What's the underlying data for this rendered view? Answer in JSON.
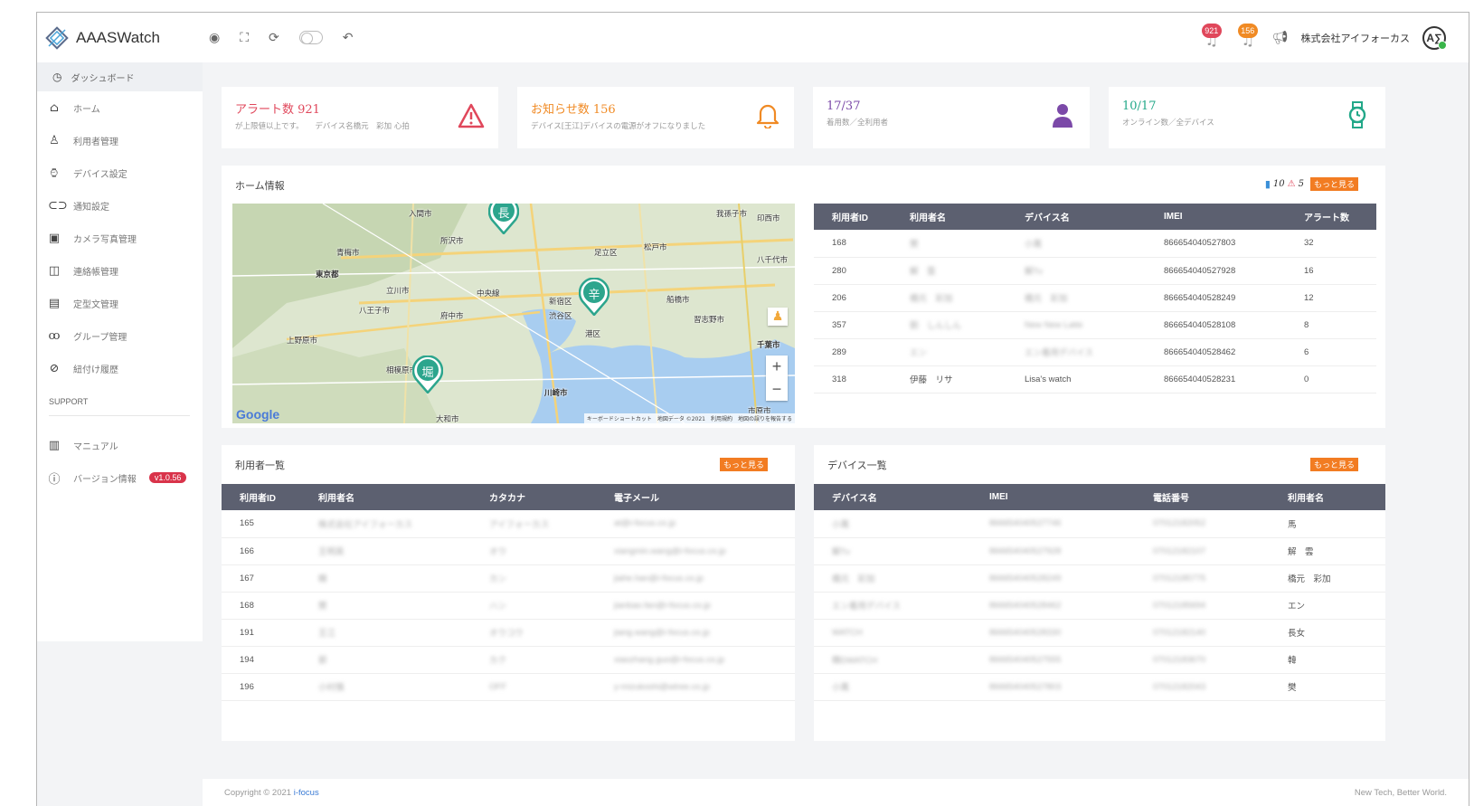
{
  "app": {
    "name": "AAASWatch"
  },
  "topbar": {
    "alerts_badge": "921",
    "notices_badge": "156",
    "company": "株式会社アイフォーカス",
    "avatar_text": "A∑"
  },
  "sidebar": {
    "header": "ダッシュボード",
    "items": [
      {
        "label": "ホーム",
        "icon": "home-icon"
      },
      {
        "label": "利用者管理",
        "icon": "user-icon"
      },
      {
        "label": "デバイス設定",
        "icon": "watch-icon"
      },
      {
        "label": "通知設定",
        "icon": "link-icon"
      },
      {
        "label": "カメラ写真管理",
        "icon": "image-icon"
      },
      {
        "label": "連絡帳管理",
        "icon": "book-icon"
      },
      {
        "label": "定型文管理",
        "icon": "document-icon"
      },
      {
        "label": "グループ管理",
        "icon": "group-icon"
      },
      {
        "label": "紐付け履歴",
        "icon": "chain-icon"
      }
    ],
    "support_label": "SUPPORT",
    "manual": "マニュアル",
    "version_label": "バージョン情報",
    "version": "v1.0.56"
  },
  "stats": {
    "alerts": {
      "title": "アラート数 921",
      "sub": "が上限値以上です。　　デバイス名橋元　彩加 心拍",
      "color": "#e0475b"
    },
    "notices": {
      "title": "お知らせ数 156",
      "sub": "デバイス[王江]デバイスの電源がオフになりました",
      "color": "#f08a24"
    },
    "wearing": {
      "title": "17/37",
      "sub": "着用数／全利用者",
      "color": "#7b49a8"
    },
    "online": {
      "title": "10/17",
      "sub": "オンライン数／全デバイス",
      "color": "#23a889"
    }
  },
  "home_info": {
    "title": "ホーム情報",
    "count_bar": "10",
    "count_alert": "5",
    "more": "もっと見る",
    "map": {
      "labels": [
        "青梅市",
        "東京都",
        "立川市",
        "八王子市",
        "府中市",
        "新宿区",
        "渋谷区",
        "港区",
        "足立区",
        "松戸市",
        "船橋市",
        "八千代市",
        "習志野市",
        "千葉市",
        "川崎市",
        "相模原市",
        "大和市",
        "所沢市",
        "入間市",
        "市原市",
        "我孫子市",
        "印西市",
        "上野原市",
        "中央線"
      ],
      "pins": [
        "長",
        "辛",
        "堀"
      ],
      "google": "Google",
      "attribution": "キーボードショートカット　地図データ ©2021　利用規約　地図の誤りを報告する"
    },
    "columns": [
      "利用者ID",
      "利用者名",
      "デバイス名",
      "IMEI",
      "アラート数"
    ],
    "rows": [
      [
        "168",
        "樊",
        "小萬",
        "866654040527803",
        "32"
      ],
      [
        "280",
        "解　雲",
        "解Tv",
        "866654040527928",
        "16"
      ],
      [
        "206",
        "橋元　彩加",
        "橋元　彩加",
        "866654040528249",
        "12"
      ],
      [
        "357",
        "劉　しんしん",
        "New New Latte",
        "866654040528108",
        "8"
      ],
      [
        "289",
        "エン",
        "エン着用デバイス",
        "866654040528462",
        "6"
      ],
      [
        "318",
        "伊藤　リサ",
        "Lisa's watch",
        "866654040528231",
        "0"
      ]
    ]
  },
  "users": {
    "title": "利用者一覧",
    "more": "もっと見る",
    "columns": [
      "利用者ID",
      "利用者名",
      "カタカナ",
      "電子メール"
    ],
    "rows": [
      [
        "165",
        "株式会社アイフォーカス",
        "アイフォーカス",
        "at@i-focus.co.jp"
      ],
      [
        "166",
        "王明英",
        "オウ",
        "xiangmin.wang@i-focus.co.jp"
      ],
      [
        "167",
        "韓",
        "カン",
        "jiahe.han@i-focus.co.jp"
      ],
      [
        "168",
        "樊",
        "ハン",
        "jianbao.fan@i-focus.co.jp"
      ],
      [
        "191",
        "王江",
        "オウコウ",
        "jiang.wang@i-focus.co.jp"
      ],
      [
        "194",
        "郭",
        "カク",
        "xiaozhang.guo@i-focus.co.jp"
      ],
      [
        "196",
        "小村慎",
        "OFF",
        "y-mizukoshi@wtree.co.jp"
      ]
    ]
  },
  "devices": {
    "title": "デバイス一覧",
    "more": "もっと見る",
    "columns": [
      "デバイス名",
      "IMEI",
      "電話番号",
      "利用者名"
    ],
    "rows": [
      [
        "小萬",
        "866654040527746",
        "07012182052",
        "馬"
      ],
      [
        "解Tv",
        "866654040527928",
        "07012182107",
        "解　雲"
      ],
      [
        "橋元　彩加",
        "866654040528249",
        "07012185775",
        "橋元　彩加"
      ],
      [
        "エン着用デバイス",
        "866654040528462",
        "07012185694",
        "エン"
      ],
      [
        "WATCH",
        "866654040528330",
        "07012182140",
        "長女"
      ],
      [
        "韓DWATCH",
        "866654040527555",
        "07012183670",
        "韓"
      ],
      [
        "小萬",
        "866654040527803",
        "07012182043",
        "樊"
      ]
    ]
  },
  "footer": {
    "copyright": "Copyright © 2021 ",
    "company_link": "i-focus",
    "slogan": "New Tech, Better World."
  }
}
